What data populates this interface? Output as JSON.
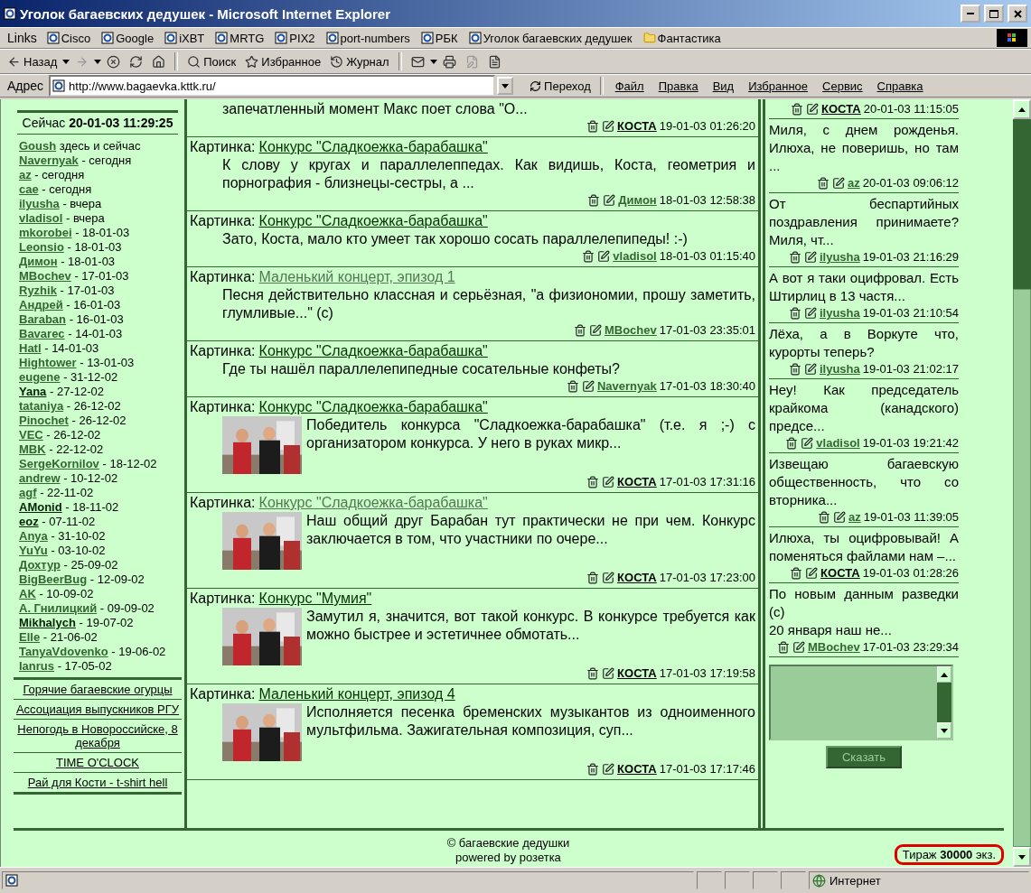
{
  "window": {
    "title": "Уголок багаевских дедушек - Microsoft Internet Explorer"
  },
  "links_bar": {
    "label": "Links",
    "items": [
      {
        "kind": "page",
        "label": "Cisco"
      },
      {
        "kind": "page",
        "label": "Google"
      },
      {
        "kind": "page",
        "label": "iXBT"
      },
      {
        "kind": "page",
        "label": "MRTG"
      },
      {
        "kind": "page",
        "label": "PIX2"
      },
      {
        "kind": "page",
        "label": "port-numbers"
      },
      {
        "kind": "page",
        "label": "РБК"
      },
      {
        "kind": "page",
        "label": "Уголок багаевских дедушек"
      },
      {
        "kind": "folder",
        "label": "Фантастика"
      }
    ]
  },
  "toolbar": [
    {
      "kind": "back",
      "label": "Назад",
      "disabled": false
    },
    {
      "kind": "forward",
      "disabled": true
    },
    {
      "kind": "stop",
      "disabled": false
    },
    {
      "kind": "refresh",
      "disabled": false
    },
    {
      "kind": "home",
      "disabled": false
    },
    {
      "kind": "search",
      "label": "Поиск",
      "disabled": false
    },
    {
      "kind": "favorites",
      "label": "Избранное",
      "disabled": false
    },
    {
      "kind": "history",
      "label": "Журнал",
      "disabled": false
    },
    {
      "kind": "mail",
      "disabled": false
    },
    {
      "kind": "print",
      "disabled": false
    },
    {
      "kind": "edit",
      "disabled": true
    },
    {
      "kind": "discuss",
      "disabled": false
    }
  ],
  "address_bar": {
    "label": "Адрес",
    "value": "http://www.bagaevka.kttk.ru/",
    "go_button": "Переход"
  },
  "menu": [
    "Файл",
    "Правка",
    "Вид",
    "Избранное",
    "Сервис",
    "Справка"
  ],
  "sidebar": {
    "now_label": "Сейчас",
    "now_value": "20-01-03 11:29:25",
    "users": [
      {
        "name": "Goush",
        "note": "здесь и сейчас",
        "highlighted": false
      },
      {
        "name": "Navernyak",
        "note": "- сегодня",
        "highlighted": false
      },
      {
        "name": "az",
        "note": "- сегодня",
        "highlighted": false
      },
      {
        "name": "cae",
        "note": "- сегодня",
        "highlighted": false
      },
      {
        "name": "ilyusha",
        "note": "- вчера",
        "highlighted": false
      },
      {
        "name": "vladisol",
        "note": "- вчера",
        "highlighted": false
      },
      {
        "name": "mkorobei",
        "note": "- 18-01-03",
        "highlighted": false
      },
      {
        "name": "Leonsio",
        "note": "- 18-01-03",
        "highlighted": false
      },
      {
        "name": "Димон",
        "note": "- 18-01-03",
        "highlighted": false
      },
      {
        "name": "MBochev",
        "note": "- 17-01-03",
        "highlighted": false
      },
      {
        "name": "Ryzhik",
        "note": "- 17-01-03",
        "highlighted": false
      },
      {
        "name": "Андрей",
        "note": "- 16-01-03",
        "highlighted": false
      },
      {
        "name": "Baraban",
        "note": "- 16-01-03",
        "highlighted": false
      },
      {
        "name": "Bavarec",
        "note": "- 14-01-03",
        "highlighted": false
      },
      {
        "name": "Hatl",
        "note": "- 14-01-03",
        "highlighted": false
      },
      {
        "name": "Hightower",
        "note": "- 13-01-03",
        "highlighted": false
      },
      {
        "name": "eugene",
        "note": "- 31-12-02",
        "highlighted": false
      },
      {
        "name": "Yana",
        "note": "- 27-12-02",
        "highlighted": true
      },
      {
        "name": "tataniya",
        "note": "- 26-12-02",
        "highlighted": false
      },
      {
        "name": "Pinochet",
        "note": "- 26-12-02",
        "highlighted": false
      },
      {
        "name": "VEC",
        "note": "- 26-12-02",
        "highlighted": false
      },
      {
        "name": "MBK",
        "note": "- 22-12-02",
        "highlighted": false
      },
      {
        "name": "SergeKornilov",
        "note": "- 18-12-02",
        "highlighted": false
      },
      {
        "name": "andrew",
        "note": "- 10-12-02",
        "highlighted": false
      },
      {
        "name": "agf",
        "note": "- 22-11-02",
        "highlighted": false
      },
      {
        "name": "AMonid",
        "note": "- 18-11-02",
        "highlighted": true
      },
      {
        "name": "eoz",
        "note": "- 07-11-02",
        "highlighted": true
      },
      {
        "name": "Anya",
        "note": "- 31-10-02",
        "highlighted": false
      },
      {
        "name": "YuYu",
        "note": "- 03-10-02",
        "highlighted": false
      },
      {
        "name": "Дохтур",
        "note": "- 25-09-02",
        "highlighted": false
      },
      {
        "name": "BigBeerBug",
        "note": "- 12-09-02",
        "highlighted": false
      },
      {
        "name": "AK",
        "note": "- 10-09-02",
        "highlighted": false
      },
      {
        "name": "А. Гнилицкий",
        "note": "- 09-09-02",
        "highlighted": false
      },
      {
        "name": "Mikhalych",
        "note": "- 19-07-02",
        "highlighted": true
      },
      {
        "name": "Elle",
        "note": "- 21-06-02",
        "highlighted": false
      },
      {
        "name": "TanyaVdovenko",
        "note": "- 19-06-02",
        "highlighted": false
      },
      {
        "name": "Ianrus",
        "note": "- 17-05-02",
        "highlighted": false
      }
    ],
    "links": [
      "Горячие багаевские огурцы",
      "Ассоциация выпускников РГУ",
      "Непогодь в Новороссийске, 8 декабря",
      "TIME O'CLOCK",
      "Рай для Кости - t-shirt hell"
    ]
  },
  "posts": [
    {
      "text": "запечатленный момент Макс поет слова \"О...",
      "author": "КОСТА",
      "author_highlighted": true,
      "time": "19-01-03 01:26:20"
    },
    {
      "category": "Картинка:",
      "title": "Конкурс \"Сладкоежка-барабашка\"",
      "visited": false,
      "text": "К слову у кругах и параллелеппедах. Как видишь, Коста, геометрия и порнография - близнецы-сестры, а ...",
      "author": "Димон",
      "author_highlighted": false,
      "time": "18-01-03 12:58:38"
    },
    {
      "category": "Картинка:",
      "title": "Конкурс \"Сладкоежка-барабашка\"",
      "visited": false,
      "text": "Зато, Коста, мало кто умеет так хорошо сосать параллелепипеды! :-)",
      "author": "vladisol",
      "author_highlighted": false,
      "time": "18-01-03 01:15:40"
    },
    {
      "category": "Картинка:",
      "title": "Маленький концерт, эпизод 1",
      "visited": true,
      "text": "Песня действительно классная и серьёзная, \"а физиономии, прошу заметить, глумливые...\" (с)",
      "author": "MBochev",
      "author_highlighted": false,
      "time": "17-01-03 23:35:01"
    },
    {
      "category": "Картинка:",
      "title": "Конкурс \"Сладкоежка-барабашка\"",
      "visited": false,
      "text": "Где ты нашёл параллелепипедные сосательные конфеты?",
      "author": "Navernyak",
      "author_highlighted": false,
      "time": "17-01-03 18:30:40"
    },
    {
      "category": "Картинка:",
      "title": "Конкурс \"Сладкоежка-барабашка\"",
      "visited": false,
      "text": "Победитель конкурса \"Сладкоежка-барабашка\" (т.е. я ;-) с организатором конкурса. У него в руках микр...",
      "author": "КОСТА",
      "author_highlighted": true,
      "time": "17-01-03 17:31:16"
    },
    {
      "category": "Картинка:",
      "title": "Конкурс \"Сладкоежка-барабашка\"",
      "visited": true,
      "text": "Наш общий друг Барабан тут практически не при чем. Конкурс заключается в том, что участники по очере...",
      "author": "КОСТА",
      "author_highlighted": true,
      "time": "17-01-03 17:23:00"
    },
    {
      "category": "Картинка:",
      "title": "Конкурс \"Мумия\"",
      "visited": false,
      "text": "Замутил я, значится, вот такой конкурс. В конкурсе требуется как можно быстрее и эстетичнее обмотать...",
      "author": "КОСТА",
      "author_highlighted": true,
      "time": "17-01-03 17:19:58"
    },
    {
      "category": "Картинка:",
      "title": "Маленький концерт, эпизод 4",
      "visited": false,
      "text": "Исполняется песенка бременских музыкантов из одноименного мультфильма. Зажигательная композиция, суп...",
      "author": "КОСТА",
      "author_highlighted": true,
      "time": "17-01-03 17:17:46"
    }
  ],
  "comments": [
    {
      "author": "КОСТА",
      "author_highlighted": true,
      "time": "20-01-03 11:15:05"
    },
    {
      "text": "Миля, с днем рожденья. Илюха, не поверишь, но там ...",
      "author": "az",
      "author_highlighted": false,
      "time": "20-01-03 09:06:12"
    },
    {
      "text": "От беспартийных поздравления принимаете? Миля, чт...",
      "author": "ilyusha",
      "author_highlighted": false,
      "time": "19-01-03 21:16:29"
    },
    {
      "text": "А вот я таки оцифровал. Есть Штирлиц в 13 частя...",
      "author": "ilyusha",
      "author_highlighted": false,
      "time": "19-01-03 21:10:54"
    },
    {
      "text": "Лёха, а в Воркуте что, курорты теперь?",
      "author": "ilyusha",
      "author_highlighted": false,
      "time": "19-01-03 21:02:17"
    },
    {
      "text": "Неу! Как председатель крайкома (канадского) предсе...",
      "author": "vladisol",
      "author_highlighted": false,
      "time": "19-01-03 19:21:42"
    },
    {
      "text": "Извещаю багаевскую общественность, что со вторника...",
      "author": "az",
      "author_highlighted": false,
      "time": "19-01-03 11:39:05"
    },
    {
      "text": "Илюха, ты оцифровывай! А поменяться файлами нам –...",
      "author": "КОСТА",
      "author_highlighted": true,
      "time": "19-01-03 01:28:26"
    },
    {
      "text": "По новым данным разведки (с)\n20 января наш не...",
      "author": "MBochev",
      "author_highlighted": false,
      "time": "17-01-03 23:29:34"
    }
  ],
  "say_button": "Сказать",
  "footer": {
    "copyright": "© багаевские дедушки",
    "powered": "powered by розетка",
    "circulation": "Тираж **30000** экз."
  },
  "status_bar": {
    "zone": "Интернет"
  }
}
